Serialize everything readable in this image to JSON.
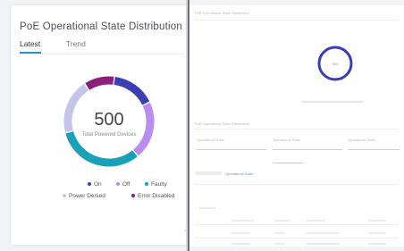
{
  "card": {
    "title": "PoE Operational State Distribution",
    "tabs": [
      {
        "label": "Latest",
        "active": true
      },
      {
        "label": "Trend",
        "active": false
      }
    ]
  },
  "chart_data": {
    "type": "pie",
    "variant": "donut",
    "center_value": "500",
    "center_label": "Total Powered Devices",
    "legend": [
      {
        "label": "On",
        "color": "#3b3fb2"
      },
      {
        "label": "Off",
        "color": "#b98cf0"
      },
      {
        "label": "Faulty",
        "color": "#1aa0b8"
      },
      {
        "label": "Power Denied",
        "color": "#c5c5ea"
      },
      {
        "label": "Error Disabled",
        "color": "#8b1f7a"
      }
    ],
    "slices": [
      {
        "label": "On",
        "value": 16,
        "color": "#3b3fb2"
      },
      {
        "label": "Off",
        "value": 21,
        "color": "#b98cf0"
      },
      {
        "label": "Faulty",
        "value": 32,
        "color": "#1aa0b8"
      },
      {
        "label": "Power Denied",
        "value": 20,
        "color": "#c5c5ea"
      },
      {
        "label": "Error Disabled",
        "value": 11,
        "color": "#8b1f7a"
      }
    ]
  },
  "right_panel": {
    "section1_title": "PoE Operational State Distribution",
    "mini_donut_value": "500",
    "section2_title": "PoE Operational State Distribution",
    "field_labels": [
      "Operational State",
      "Operational State",
      "Operational State"
    ],
    "filter_link": "Operational State"
  }
}
